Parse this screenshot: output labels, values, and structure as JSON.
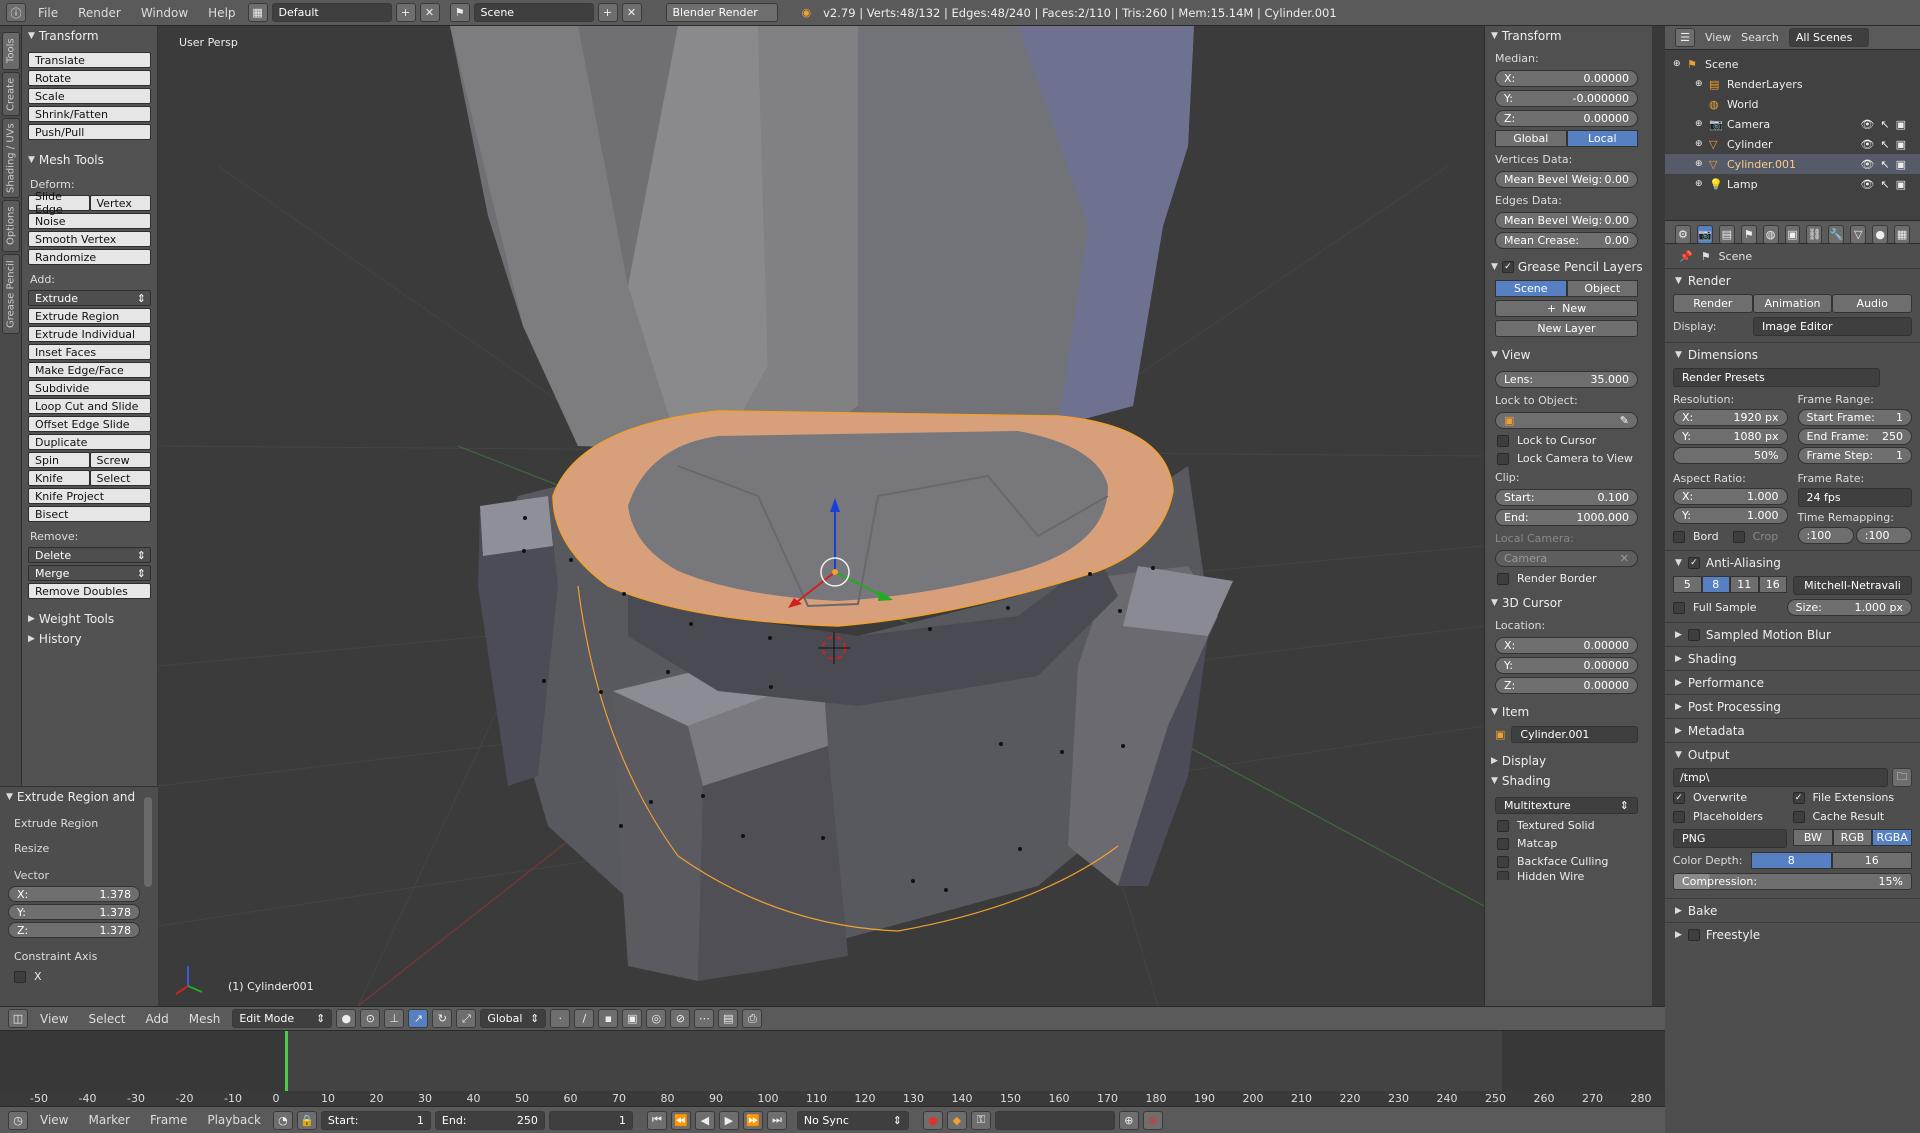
{
  "topbar": {
    "menus": [
      "File",
      "Render",
      "Window",
      "Help"
    ],
    "layout": "Default",
    "scene": "Scene",
    "engine": "Blender Render",
    "stats": "v2.79 | Verts:48/132 | Edges:48/240 | Faces:2/110 | Tris:260 | Mem:15.14M | Cylinder.001"
  },
  "tabs": [
    "Tools",
    "Create",
    "Shading / UVs",
    "Options",
    "Grease Pencil"
  ],
  "toolshelf": {
    "transform_title": "Transform",
    "transform_buttons": [
      "Translate",
      "Rotate",
      "Scale",
      "Shrink/Fatten",
      "Push/Pull"
    ],
    "mesh_tools_title": "Mesh Tools",
    "deform_label": "Deform:",
    "slide_edge": "Slide Edge",
    "vertex": "Vertex",
    "deform_buttons": [
      "Noise",
      "Smooth Vertex",
      "Randomize"
    ],
    "add_label": "Add:",
    "extrude": "Extrude",
    "add_buttons": [
      "Extrude Region",
      "Extrude Individual",
      "Inset Faces",
      "Make Edge/Face",
      "Subdivide",
      "Loop Cut and Slide",
      "Offset Edge Slide",
      "Duplicate"
    ],
    "spin": "Spin",
    "screw": "Screw",
    "knife": "Knife",
    "select": "Select",
    "knife_project": "Knife Project",
    "bisect": "Bisect",
    "remove_label": "Remove:",
    "delete": "Delete",
    "merge": "Merge",
    "remove_doubles": "Remove Doubles",
    "weight_tools": "Weight Tools",
    "history": "History"
  },
  "operator": {
    "title": "Extrude Region and",
    "items": [
      "Extrude Region",
      "Resize"
    ],
    "vector_label": "Vector",
    "x_label": "X:",
    "x": "1.378",
    "y_label": "Y:",
    "y": "1.378",
    "z_label": "Z:",
    "z": "1.378",
    "constraint_label": "Constraint Axis",
    "constraint_x": "X"
  },
  "viewport": {
    "persp_label": "User Persp",
    "object_label": "(1) Cylinder001"
  },
  "vheader": {
    "menus": [
      "View",
      "Select",
      "Add",
      "Mesh"
    ],
    "mode": "Edit Mode",
    "orientation": "Global"
  },
  "timeline": {
    "ticks": [
      "-50",
      "-40",
      "-30",
      "-20",
      "-10",
      "0",
      "10",
      "20",
      "30",
      "40",
      "50",
      "60",
      "70",
      "80",
      "90",
      "100",
      "110",
      "120",
      "130",
      "140",
      "150",
      "160",
      "170",
      "180",
      "190",
      "200",
      "210",
      "220",
      "230",
      "240",
      "250",
      "260",
      "270",
      "280"
    ],
    "menus": [
      "View",
      "Marker",
      "Frame",
      "Playback"
    ],
    "start_label": "Start:",
    "start": "1",
    "end_label": "End:",
    "end": "250",
    "current": "1",
    "sync": "No Sync"
  },
  "npanel": {
    "transform_title": "Transform",
    "median_label": "Median:",
    "mx_label": "X:",
    "mx": "0.00000",
    "my_label": "Y:",
    "my": "-0.000000",
    "mz_label": "Z:",
    "mz": "0.00000",
    "global": "Global",
    "local": "Local",
    "vertices_data": "Vertices Data:",
    "mean_bevel_v_label": "Mean Bevel Weig:",
    "mean_bevel_v": "0.00",
    "edges_data": "Edges Data:",
    "mean_bevel_e_label": "Mean Bevel Weig:",
    "mean_bevel_e": "0.00",
    "mean_crease_label": "Mean Crease:",
    "mean_crease": "0.00",
    "grease_title": "Grease Pencil Layers",
    "gp_scene": "Scene",
    "gp_object": "Object",
    "new": "New",
    "new_layer": "New Layer",
    "view_title": "View",
    "lens_label": "Lens:",
    "lens": "35.000",
    "lock_to_object": "Lock to Object:",
    "lock_to_cursor": "Lock to Cursor",
    "lock_camera": "Lock Camera to View",
    "clip_label": "Clip:",
    "clip_start_label": "Start:",
    "clip_start": "0.100",
    "clip_end_label": "End:",
    "clip_end": "1000.000",
    "local_camera": "Local Camera:",
    "camera": "Camera",
    "render_border": "Render Border",
    "cursor_title": "3D Cursor",
    "location_label": "Location:",
    "cx_label": "X:",
    "cx": "0.00000",
    "cy_label": "Y:",
    "cy": "0.00000",
    "cz_label": "Z:",
    "cz": "0.00000",
    "item_title": "Item",
    "item_name": "Cylinder.001",
    "display_title": "Display",
    "shading_title": "Shading",
    "shading_mode": "Multitexture",
    "textured_solid": "Textured Solid",
    "matcap": "Matcap",
    "backface": "Backface Culling",
    "hidden_wire": "Hidden Wire"
  },
  "outliner": {
    "view": "View",
    "search": "Search",
    "filter": "All Scenes",
    "rows": [
      {
        "label": "Scene",
        "indent": 0
      },
      {
        "label": "RenderLayers",
        "indent": 1
      },
      {
        "label": "World",
        "indent": 1
      },
      {
        "label": "Camera",
        "indent": 1
      },
      {
        "label": "Cylinder",
        "indent": 1
      },
      {
        "label": "Cylinder.001",
        "indent": 1
      },
      {
        "label": "Lamp",
        "indent": 1
      }
    ]
  },
  "props": {
    "scene": "Scene",
    "render_title": "Render",
    "render_btn": "Render",
    "animation_btn": "Animation",
    "audio_btn": "Audio",
    "display_label": "Display:",
    "display_value": "Image Editor",
    "dimensions_title": "Dimensions",
    "render_presets": "Render Presets",
    "resolution_label": "Resolution:",
    "res_x_label": "X:",
    "res_x": "1920 px",
    "res_y_label": "Y:",
    "res_y": "1080 px",
    "res_pct": "50%",
    "frame_range_label": "Frame Range:",
    "start_frame_label": "Start Frame:",
    "start_frame": "1",
    "end_frame_label": "End Frame:",
    "end_frame": "250",
    "frame_step_label": "Frame Step:",
    "frame_step": "1",
    "aspect_label": "Aspect Ratio:",
    "ax_label": "X:",
    "ax": "1.000",
    "ay_label": "Y:",
    "ay": "1.000",
    "frame_rate_label": "Frame Rate:",
    "frame_rate": "24 fps",
    "time_remap_label": "Time Remapping:",
    "remap_old": ":100",
    "remap_new": ":100",
    "bord": "Bord",
    "crop": "Crop",
    "aa_title": "Anti-Aliasing",
    "aa_samples": [
      "5",
      "8",
      "11",
      "16"
    ],
    "aa_filter": "Mitchell-Netravali",
    "full_sample": "Full Sample",
    "size_label": "Size:",
    "size": "1.000 px",
    "sampled_motion_blur": "Sampled Motion Blur",
    "shading": "Shading",
    "performance": "Performance",
    "post_processing": "Post Processing",
    "metadata": "Metadata",
    "output_title": "Output",
    "output_path": "/tmp\\",
    "overwrite": "Overwrite",
    "file_extensions": "File Extensions",
    "placeholders": "Placeholders",
    "cache_result": "Cache Result",
    "format": "PNG",
    "bw": "BW",
    "rgb": "RGB",
    "rgba": "RGBA",
    "color_depth_label": "Color Depth:",
    "depth_8": "8",
    "depth_16": "16",
    "compression_label": "Compression:",
    "compression": "15%",
    "bake": "Bake",
    "freestyle": "Freestyle"
  },
  "colors": {
    "accent": "#5680c2",
    "selected_face": "#d8a07a",
    "selected_edge": "#f0a030"
  }
}
